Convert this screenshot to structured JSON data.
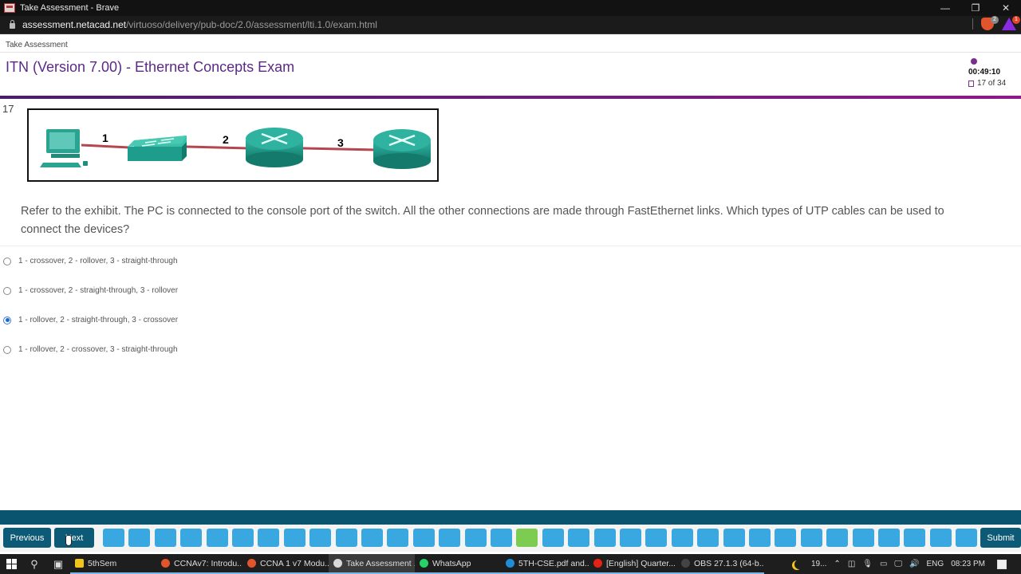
{
  "browser": {
    "window_title": "Take Assessment - Brave",
    "url_host": "assessment.netacad.net",
    "url_path": "/virtuoso/delivery/pub-doc/2.0/assessment/lti.1.0/exam.html",
    "shields_badge": "2",
    "rewards_badge": "1",
    "controls": {
      "minimize": "—",
      "restore": "❐",
      "close": "✕"
    }
  },
  "header": {
    "breadcrumb": "Take Assessment",
    "exam_title": "ITN (Version 7.00) - Ethernet Concepts Exam",
    "timer": "00:49:10",
    "question_counter": "17 of 34"
  },
  "question": {
    "number": "17",
    "exhibit": {
      "devices": [
        "PC",
        "Switch",
        "Router",
        "Router"
      ],
      "link_labels": [
        "1",
        "2",
        "3"
      ],
      "link_color": "#b5454f",
      "device_color": "#1f9d8c"
    },
    "text": "Refer to the exhibit. The PC is connected to the console port of the switch. All the other connections are made through FastEthernet links. Which types of UTP cables can be used to connect the devices?",
    "options": [
      {
        "label": "1 - crossover, 2 - rollover, 3 - straight-through",
        "selected": false
      },
      {
        "label": "1 - crossover, 2 - straight-through, 3 - rollover",
        "selected": false
      },
      {
        "label": "1 - rollover, 2 - straight-through, 3 - crossover",
        "selected": true
      },
      {
        "label": "1 - rollover, 2 - crossover, 3 - straight-through",
        "selected": false
      }
    ]
  },
  "navigation": {
    "previous_label": "Previous",
    "next_label": "Next",
    "submit_label": "Submit",
    "total_questions": 34,
    "current_question": 17,
    "colors": {
      "unanswered": "#3aa8e0",
      "current": "#7ccc52",
      "button": "#0d5a76"
    }
  },
  "taskbar": {
    "apps": [
      {
        "label": "5thSem",
        "icon": "folder-icon",
        "color": "#f0c419",
        "active": false
      },
      {
        "label": "CCNAv7: Introdu...",
        "icon": "brave-icon",
        "color": "#e2552c",
        "active": false
      },
      {
        "label": "CCNA 1 v7 Modu...",
        "icon": "brave-icon",
        "color": "#e2552c",
        "active": false
      },
      {
        "label": "Take Assessment ...",
        "icon": "netacad-icon",
        "color": "#d8d8d8",
        "active": true
      },
      {
        "label": "WhatsApp",
        "icon": "whatsapp-icon",
        "color": "#25d366",
        "active": false
      },
      {
        "label": "5TH-CSE.pdf and...",
        "icon": "edge-icon",
        "color": "#1e8fd6",
        "active": false
      },
      {
        "label": "[English] Quarter...",
        "icon": "youtube-icon",
        "color": "#e62117",
        "active": false
      },
      {
        "label": "OBS 27.1.3 (64-b...",
        "icon": "obs-icon",
        "color": "#444444",
        "active": false
      }
    ],
    "weather": "19...",
    "language": "ENG",
    "time": "08:23 PM"
  }
}
